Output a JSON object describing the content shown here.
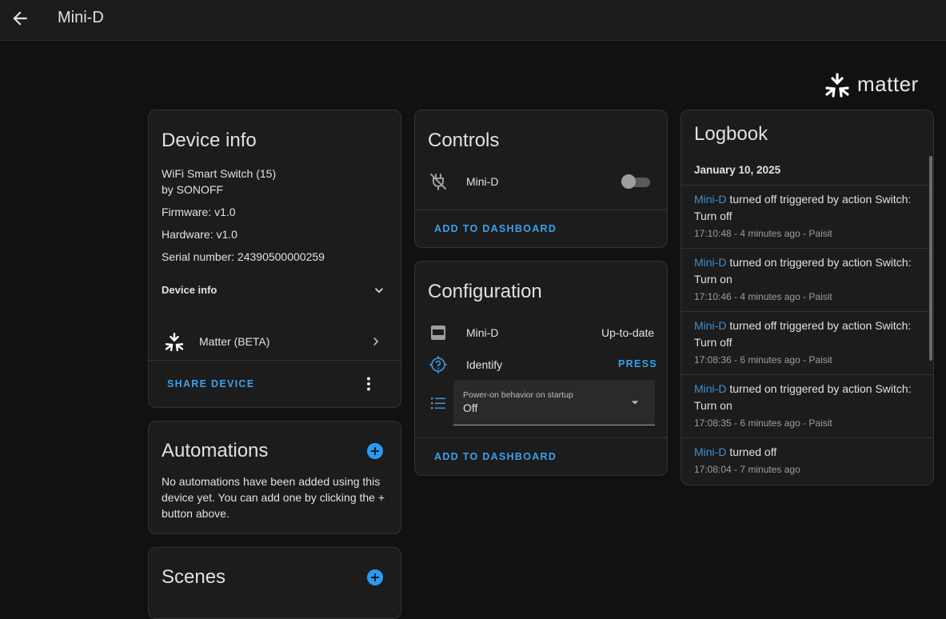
{
  "header": {
    "title": "Mini-D"
  },
  "logo": {
    "text": "matter"
  },
  "device_info": {
    "title": "Device info",
    "model": "WiFi Smart Switch (15)",
    "manufacturer": "by SONOFF",
    "firmware": "Firmware: v1.0",
    "hardware": "Hardware: v1.0",
    "serial": "Serial number: 24390500000259",
    "expand_label": "Device info",
    "integration": "Matter (BETA)",
    "share_label": "SHARE DEVICE"
  },
  "automations": {
    "title": "Automations",
    "empty_text_1": "No automations have been added using this",
    "empty_text_2": "device yet. You can add one by clicking the +",
    "empty_text_3": "button above."
  },
  "scenes": {
    "title": "Scenes"
  },
  "controls": {
    "title": "Controls",
    "entity": "Mini-D",
    "toggle_state": "off",
    "add_label": "ADD TO DASHBOARD"
  },
  "configuration": {
    "title": "Configuration",
    "firmware_entity": "Mini-D",
    "firmware_state": "Up-to-date",
    "identify_label": "Identify",
    "press_label": "PRESS",
    "select_label": "Power-on behavior on startup",
    "select_value": "Off",
    "add_label": "ADD TO DASHBOARD"
  },
  "logbook": {
    "title": "Logbook",
    "date": "January 10, 2025",
    "entries": [
      {
        "entity": "Mini-D",
        "line1": " turned off triggered by action Switch:",
        "line2": "Turn off",
        "time": "17:10:48 - 4 minutes ago - Paisit"
      },
      {
        "entity": "Mini-D",
        "line1": " turned on triggered by action Switch:",
        "line2": "Turn on",
        "time": "17:10:46 - 4 minutes ago - Paisit"
      },
      {
        "entity": "Mini-D",
        "line1": " turned off triggered by action Switch:",
        "line2": "Turn off",
        "time": "17:08:36 - 6 minutes ago - Paisit"
      },
      {
        "entity": "Mini-D",
        "line1": " turned on triggered by action Switch:",
        "line2": "Turn on",
        "time": "17:08:35 - 6 minutes ago - Paisit"
      },
      {
        "entity": "Mini-D",
        "line1": " turned off",
        "line2": "",
        "time": "17:08:04 - 7 minutes ago"
      }
    ]
  },
  "colors": {
    "accent": "#3aa1ec",
    "background": "#111111",
    "card": "#1c1c1c"
  }
}
